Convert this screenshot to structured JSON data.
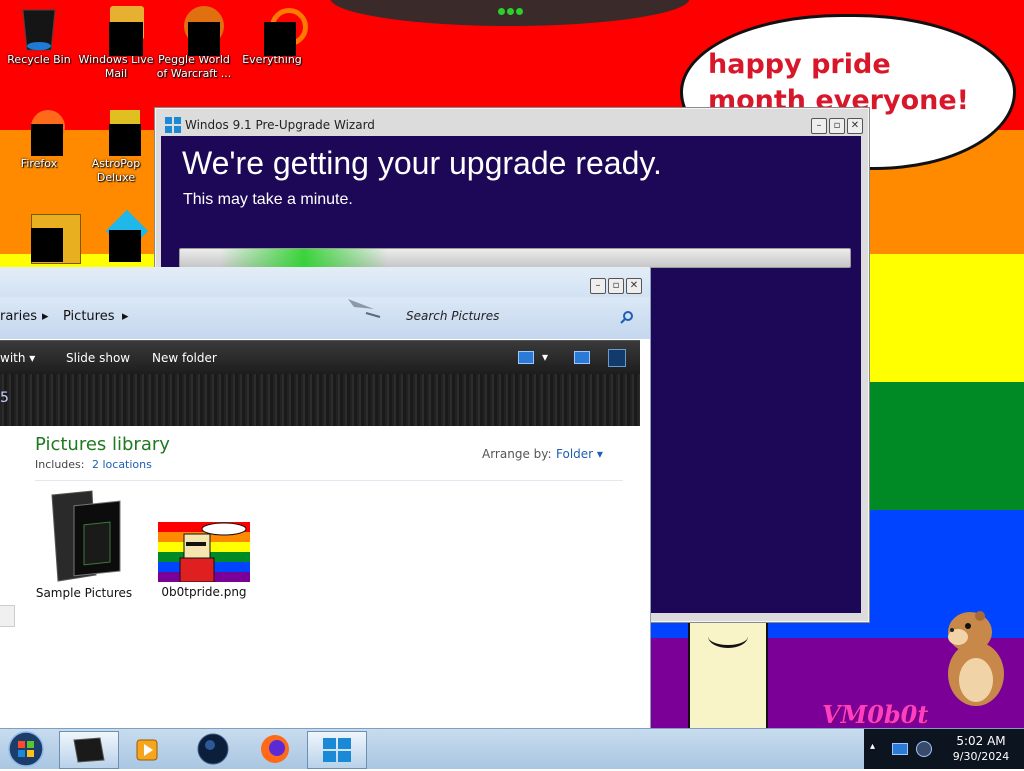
{
  "wallpaper": {
    "stripe_colors": [
      "#ff0000",
      "#ff8a00",
      "#ffff00",
      "#008a26",
      "#0044ff",
      "#7a0097"
    ],
    "bubble_text": "happy pride month everyone!",
    "watermark": "VM0b0t"
  },
  "desktop_icons": [
    {
      "label": "Recycle Bin",
      "icon": "recycle-bin-icon"
    },
    {
      "label": "Windows Live Mail",
      "icon": "mail-icon"
    },
    {
      "label": "Peggle World of Warcraft ...",
      "icon": "peggle-icon"
    },
    {
      "label": "Everything",
      "icon": "everything-search-icon"
    },
    {
      "label": "Firefox",
      "icon": "firefox-icon"
    },
    {
      "label": "AstroPop Deluxe",
      "icon": "astropop-icon"
    },
    {
      "label": "",
      "icon": "app-icon"
    },
    {
      "label": "",
      "icon": "gem-icon"
    }
  ],
  "wizard": {
    "title": "Windos 9.1 Pre-Upgrade Wizard",
    "heading": "We're getting your upgrade ready.",
    "subtext": "This may take a minute.",
    "progress_fraction": 0.25
  },
  "explorer": {
    "breadcrumb": [
      "raries",
      "Pictures"
    ],
    "search_placeholder": "Search Pictures",
    "toolbar": {
      "open_with": "with",
      "slideshow": "Slide show",
      "new_folder": "New folder"
    },
    "strip_text": "5",
    "library_title": "Pictures library",
    "includes_label": "Includes:",
    "includes_link": "2 locations",
    "arrange_label": "Arrange by:",
    "arrange_value": "Folder",
    "files": [
      {
        "name": "Sample Pictures",
        "type": "folder"
      },
      {
        "name": "0b0tpride.png",
        "type": "image"
      }
    ]
  },
  "taskbar": {
    "start": "start-orb-icon",
    "apps": [
      "explorer-icon",
      "media-player-icon",
      "orb-app-icon",
      "firefox-icon",
      "windows-logo-icon"
    ],
    "time": "5:02 AM",
    "date": "9/30/2024"
  }
}
